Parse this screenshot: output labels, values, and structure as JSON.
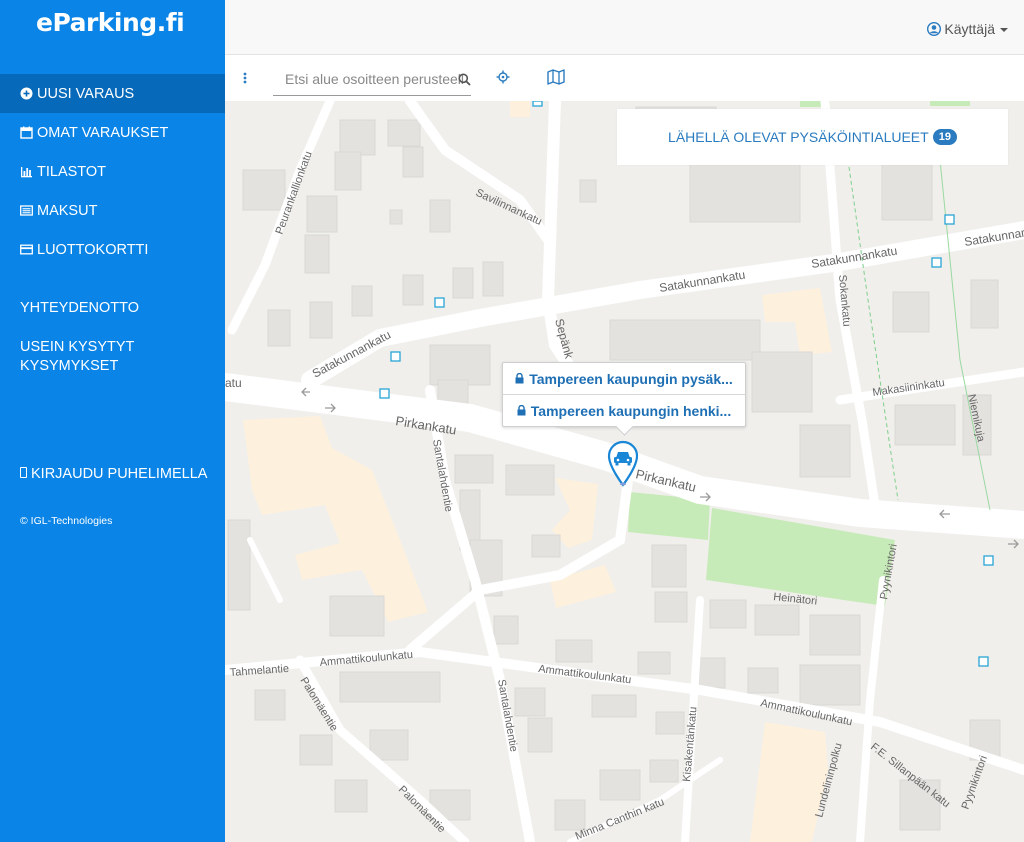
{
  "app": {
    "logo": "eParking.fi"
  },
  "sidebar": {
    "items": [
      {
        "label": "UUSI VARAUS",
        "icon": "plus-circle-icon",
        "active": true
      },
      {
        "label": "OMAT VARAUKSET",
        "icon": "calendar-icon"
      },
      {
        "label": "TILASTOT",
        "icon": "bar-chart-icon"
      },
      {
        "label": "MAKSUT",
        "icon": "list-icon"
      },
      {
        "label": "LUOTTOKORTTI",
        "icon": "credit-card-icon"
      }
    ],
    "links": [
      {
        "label": "YHTEYDENOTTO"
      },
      {
        "label": "USEIN KYSYTYT KYSYMYKSET"
      }
    ],
    "phone_login": {
      "label": "KIRJAUDU PUHELIMELLA",
      "icon": "mobile-icon"
    },
    "copyright": "© IGL-Technologies"
  },
  "header": {
    "user": {
      "label": "Käyttäjä",
      "icon": "user-circle-icon"
    }
  },
  "toolbar": {
    "search": {
      "placeholder": "Etsi alue osoitteen perusteella",
      "icon": "search-icon"
    },
    "locate_icon": "crosshair-icon",
    "map_icon": "map-icon"
  },
  "map": {
    "nearby": {
      "label": "LÄHELLÄ OLEVAT PYSÄKÖINTIALUEET",
      "count": "19"
    },
    "popup": {
      "items": [
        {
          "label": "Tampereen kaupungin pysäk..."
        },
        {
          "label": "Tampereen kaupungin henki..."
        }
      ]
    },
    "marker_icon": "car-marker-icon",
    "street_labels": {
      "satakunnankatu_1": "Satakunnankatu",
      "satakunnankatu_2": "Satakunnankatu",
      "satakunnankatu_3": "Satakunnankatu",
      "satakunnankatu_4": "Satakunnankatu",
      "pirkankatu_1": "Pirkankatu",
      "pirkankatu_2": "Pirkankatu",
      "pirkankatu_3": "atu",
      "savilinnankatu": "Savilinnankatu",
      "peurankallionkatu": "Peurankallionkatu",
      "sepank": "Sepänk",
      "sokerikatu": "Sokankatu",
      "makasiininkatu": "Makasiininkatu",
      "niemikuja": "Niemikuja",
      "santalahdentie_1": "Santalahdentie",
      "santalahdentie_2": "Santalahdentie",
      "heinatori": "Heinätori",
      "pyynikintori_1": "Pyynikintori",
      "pyynikintori_2": "Pyynikintori",
      "tahmelantie": "Tahmelantie",
      "ammattikoulunkatu_1": "Ammattikoulunkatu",
      "ammattikoulunkatu_2": "Ammattikoulunkatu",
      "ammattikoulunkatu_3": "Ammattikoulunkatu",
      "palomaentie_1": "Palomäentie",
      "palomaentie_2": "Palomäentie",
      "kisakentankatu": "Kisakentänkatu",
      "lundelininpolku": "Lundelininpolku",
      "sillanpaankatu": "F.E. Sillanpään katu",
      "minna_canthin_katu": "Minna Canthin katu"
    }
  }
}
